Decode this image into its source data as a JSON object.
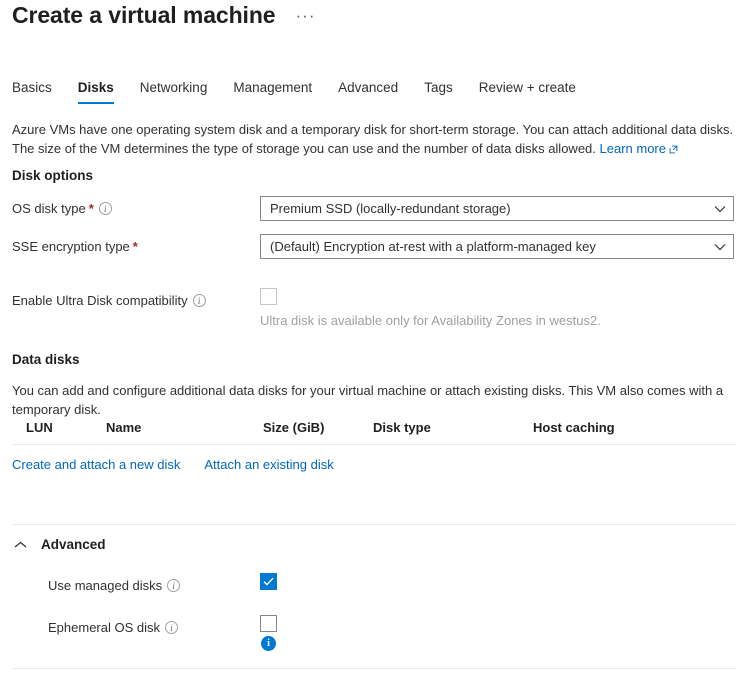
{
  "header": {
    "title": "Create a virtual machine",
    "more_label": "···"
  },
  "tabs": [
    {
      "label": "Basics",
      "active": false
    },
    {
      "label": "Disks",
      "active": true
    },
    {
      "label": "Networking",
      "active": false
    },
    {
      "label": "Management",
      "active": false
    },
    {
      "label": "Advanced",
      "active": false
    },
    {
      "label": "Tags",
      "active": false
    },
    {
      "label": "Review + create",
      "active": false
    }
  ],
  "intro": {
    "text": "Azure VMs have one operating system disk and a temporary disk for short-term storage. You can attach additional data disks. The size of the VM determines the type of storage you can use and the number of data disks allowed.",
    "link_label": "Learn more"
  },
  "disk_options": {
    "heading": "Disk options",
    "os_disk_type": {
      "label": "OS disk type",
      "required_marker": "*",
      "value": "Premium SSD (locally-redundant storage)"
    },
    "sse_encryption_type": {
      "label": "SSE encryption type",
      "required_marker": "*",
      "value": "(Default) Encryption at-rest with a platform-managed key"
    },
    "ultra_disk": {
      "label": "Enable Ultra Disk compatibility",
      "checked": false,
      "hint": "Ultra disk is available only for Availability Zones in westus2."
    }
  },
  "data_disks": {
    "heading": "Data disks",
    "description": "You can add and configure additional data disks for your virtual machine or attach existing disks. This VM also comes with a temporary disk.",
    "columns": [
      "LUN",
      "Name",
      "Size (GiB)",
      "Disk type",
      "Host caching"
    ],
    "rows": [],
    "actions": [
      {
        "label": "Create and attach a new disk"
      },
      {
        "label": "Attach an existing disk"
      }
    ]
  },
  "advanced": {
    "title": "Advanced",
    "expanded": true,
    "use_managed_disks": {
      "label": "Use managed disks",
      "checked": true
    },
    "ephemeral_os_disk": {
      "label": "Ephemeral OS disk",
      "checked": false,
      "info_badge": "i"
    }
  },
  "colors": {
    "accent": "#0078d4",
    "link": "#0066bf",
    "required": "#a4262c",
    "divider": "#edebe9",
    "text": "#323130",
    "muted": "#a19f9d"
  }
}
